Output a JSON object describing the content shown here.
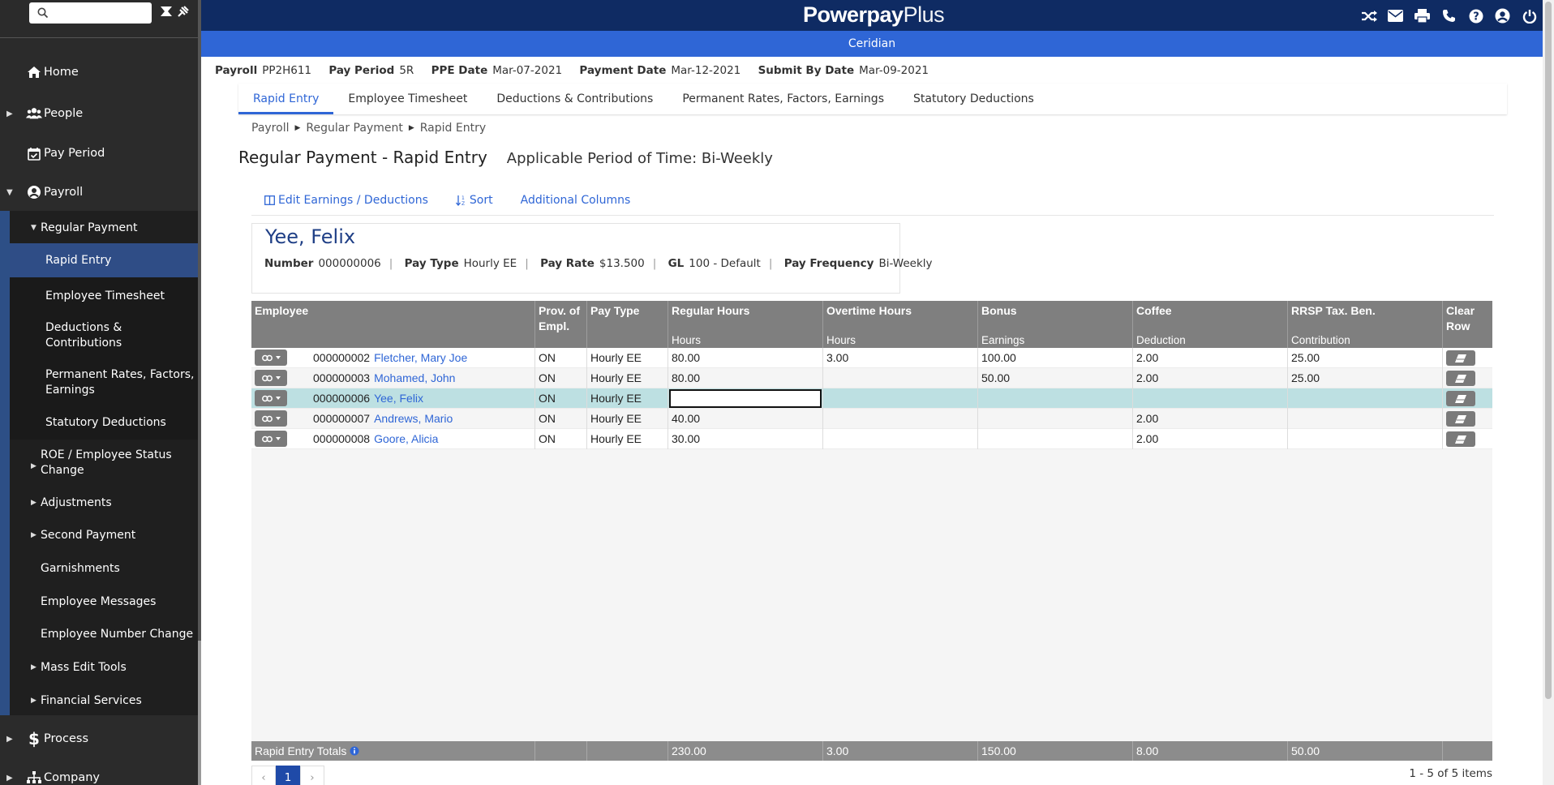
{
  "sidebar": {
    "search": {
      "placeholder": ""
    },
    "items": {
      "home": "Home",
      "people": "People",
      "pay_period": "Pay Period",
      "payroll": "Payroll",
      "process": "Process",
      "company": "Company"
    },
    "payroll_sub": {
      "regular_payment": "Regular Payment",
      "rapid_entry": "Rapid Entry",
      "employee_timesheet": "Employee Timesheet",
      "deductions": "Deductions & Contributions",
      "permanent_rates": "Permanent Rates, Factors, Earnings",
      "statutory": "Statutory Deductions",
      "roe": "ROE / Employee Status Change",
      "adjustments": "Adjustments",
      "second_payment": "Second Payment",
      "garnishments": "Garnishments",
      "employee_messages": "Employee Messages",
      "employee_number_change": "Employee Number Change",
      "mass_edit_tools": "Mass Edit Tools",
      "financial_services": "Financial Services"
    }
  },
  "header": {
    "brand_bold": "Powerpay",
    "brand_light": "Plus",
    "company": "Ceridian",
    "icons": [
      "shuffle-icon",
      "mail-icon",
      "print-icon",
      "phone-icon",
      "help-icon",
      "user-icon",
      "power-icon"
    ],
    "colors": {
      "topbar": "#0f2b63",
      "subbar": "#2f66d6"
    }
  },
  "period": {
    "payroll_label": "Payroll",
    "payroll_value": "PP2H611",
    "pay_period_label": "Pay Period",
    "pay_period_value": "5R",
    "ppe_label": "PPE Date",
    "ppe_value": "Mar-07-2021",
    "payment_label": "Payment Date",
    "payment_value": "Mar-12-2021",
    "submit_label": "Submit By Date",
    "submit_value": "Mar-09-2021"
  },
  "tabs": [
    "Rapid Entry",
    "Employee Timesheet",
    "Deductions & Contributions",
    "Permanent Rates, Factors, Earnings",
    "Statutory Deductions"
  ],
  "breadcrumb": [
    "Payroll",
    "Regular Payment",
    "Rapid Entry"
  ],
  "title": {
    "main": "Regular Payment - Rapid Entry",
    "period": "Applicable Period of Time: Bi-Weekly"
  },
  "toolbar": {
    "edit": "Edit Earnings / Deductions",
    "sort": "Sort",
    "additional": "Additional Columns"
  },
  "employee_card": {
    "name": "Yee, Felix",
    "number_label": "Number",
    "number_value": "000000006",
    "pay_type_label": "Pay Type",
    "pay_type_value": "Hourly EE",
    "pay_rate_label": "Pay Rate",
    "pay_rate_value": "$13.500",
    "gl_label": "GL",
    "gl_value": "100 - Default",
    "freq_label": "Pay Frequency",
    "freq_value": "Bi-Weekly"
  },
  "grid": {
    "columns": [
      {
        "title": "Employee",
        "sub": ""
      },
      {
        "title": "Prov. of Empl.",
        "sub": ""
      },
      {
        "title": "Pay Type",
        "sub": ""
      },
      {
        "title": "Regular Hours",
        "sub": "Hours"
      },
      {
        "title": "Overtime Hours",
        "sub": "Hours"
      },
      {
        "title": "Bonus",
        "sub": "Earnings"
      },
      {
        "title": "Coffee",
        "sub": "Deduction"
      },
      {
        "title": "RRSP Tax. Ben.",
        "sub": "Contribution"
      },
      {
        "title": "Clear Row",
        "sub": ""
      }
    ],
    "rows": [
      {
        "number": "000000002",
        "name": "Fletcher, Mary Joe",
        "prov": "ON",
        "pay_type": "Hourly EE",
        "regular": "80.00",
        "overtime": "3.00",
        "bonus": "100.00",
        "coffee": "2.00",
        "rrsp": "25.00"
      },
      {
        "number": "000000003",
        "name": "Mohamed, John",
        "prov": "ON",
        "pay_type": "Hourly EE",
        "regular": "80.00",
        "overtime": "",
        "bonus": "50.00",
        "coffee": "2.00",
        "rrsp": "25.00"
      },
      {
        "number": "000000006",
        "name": "Yee, Felix",
        "prov": "ON",
        "pay_type": "Hourly EE",
        "regular": "",
        "overtime": "",
        "bonus": "",
        "coffee": "",
        "rrsp": ""
      },
      {
        "number": "000000007",
        "name": "Andrews, Mario",
        "prov": "ON",
        "pay_type": "Hourly EE",
        "regular": "40.00",
        "overtime": "",
        "bonus": "",
        "coffee": "2.00",
        "rrsp": ""
      },
      {
        "number": "000000008",
        "name": "Goore, Alicia",
        "prov": "ON",
        "pay_type": "Hourly EE",
        "regular": "30.00",
        "overtime": "",
        "bonus": "",
        "coffee": "2.00",
        "rrsp": ""
      }
    ],
    "totals": {
      "label": "Rapid Entry Totals",
      "regular": "230.00",
      "overtime": "3.00",
      "bonus": "150.00",
      "coffee": "8.00",
      "rrsp": "50.00"
    }
  },
  "pager": {
    "current": "1",
    "info": "1 - 5 of 5 items"
  }
}
